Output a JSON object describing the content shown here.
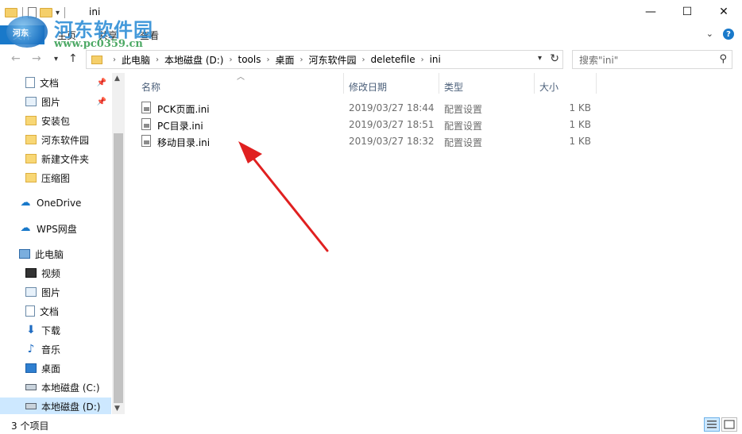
{
  "window": {
    "title": "ini",
    "minimize": "—",
    "maximize": "☐",
    "close": "✕"
  },
  "watermark": {
    "logo_text": "河东",
    "title": "河东软件园",
    "url": "www.pc0359.cn"
  },
  "ribbon": {
    "file_tab": "文件",
    "tabs": [
      "主页",
      "共享",
      "查看"
    ],
    "expand": "⌄",
    "help": "?"
  },
  "address": {
    "breadcrumbs": [
      "此电脑",
      "本地磁盘 (D:)",
      "tools",
      "桌面",
      "河东软件园",
      "deletefile",
      "ini"
    ],
    "search_placeholder": "搜索\"ini\""
  },
  "sidebar": {
    "quick_access": [
      {
        "label": "文档",
        "icon": "document-icon",
        "pinned": true
      },
      {
        "label": "图片",
        "icon": "picture-icon",
        "pinned": true
      },
      {
        "label": "安装包",
        "icon": "folder-icon"
      },
      {
        "label": "河东软件园",
        "icon": "folder-icon"
      },
      {
        "label": "新建文件夹",
        "icon": "folder-icon"
      },
      {
        "label": "压缩图",
        "icon": "folder-icon"
      }
    ],
    "onedrive": "OneDrive",
    "wps": "WPS网盘",
    "this_pc": "此电脑",
    "pc_items": [
      {
        "label": "视频",
        "icon": "video-icon"
      },
      {
        "label": "图片",
        "icon": "picture-icon"
      },
      {
        "label": "文档",
        "icon": "document-icon"
      },
      {
        "label": "下载",
        "icon": "download-icon"
      },
      {
        "label": "音乐",
        "icon": "music-icon"
      },
      {
        "label": "桌面",
        "icon": "desktop-icon"
      },
      {
        "label": "本地磁盘 (C:)",
        "icon": "drive-icon"
      },
      {
        "label": "本地磁盘 (D:)",
        "icon": "drive-icon",
        "selected": true
      }
    ]
  },
  "columns": {
    "name": "名称",
    "date": "修改日期",
    "type": "类型",
    "size": "大小"
  },
  "files": [
    {
      "name": "PCK页面.ini",
      "date": "2019/03/27 18:44",
      "type": "配置设置",
      "size": "1 KB"
    },
    {
      "name": "PC目录.ini",
      "date": "2019/03/27 18:51",
      "type": "配置设置",
      "size": "1 KB"
    },
    {
      "name": "移动目录.ini",
      "date": "2019/03/27 18:32",
      "type": "配置设置",
      "size": "1 KB"
    }
  ],
  "status": {
    "item_count": "3 个项目"
  },
  "colors": {
    "accent": "#1979ca",
    "selected": "#cde8ff",
    "annotation_arrow": "#e02020"
  }
}
